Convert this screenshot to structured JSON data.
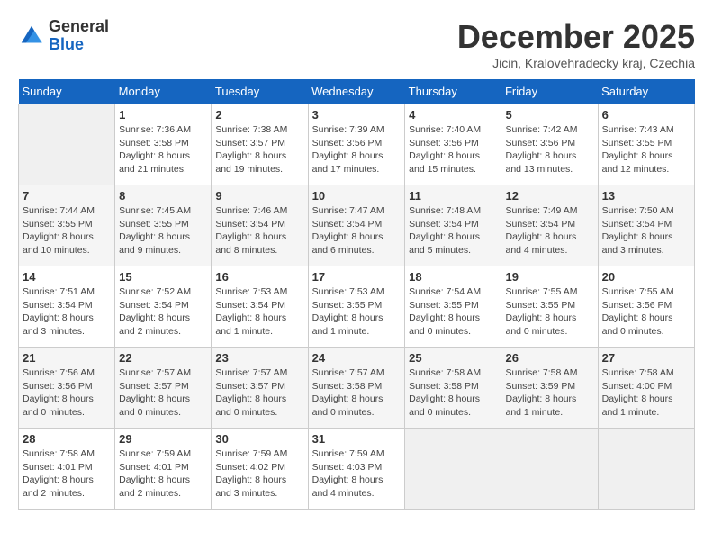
{
  "header": {
    "logo_general": "General",
    "logo_blue": "Blue",
    "title": "December 2025",
    "subtitle": "Jicin, Kralovehradecky kraj, Czechia"
  },
  "days_of_week": [
    "Sunday",
    "Monday",
    "Tuesday",
    "Wednesday",
    "Thursday",
    "Friday",
    "Saturday"
  ],
  "weeks": [
    [
      {
        "day": "",
        "info": ""
      },
      {
        "day": "1",
        "info": "Sunrise: 7:36 AM\nSunset: 3:58 PM\nDaylight: 8 hours\nand 21 minutes."
      },
      {
        "day": "2",
        "info": "Sunrise: 7:38 AM\nSunset: 3:57 PM\nDaylight: 8 hours\nand 19 minutes."
      },
      {
        "day": "3",
        "info": "Sunrise: 7:39 AM\nSunset: 3:56 PM\nDaylight: 8 hours\nand 17 minutes."
      },
      {
        "day": "4",
        "info": "Sunrise: 7:40 AM\nSunset: 3:56 PM\nDaylight: 8 hours\nand 15 minutes."
      },
      {
        "day": "5",
        "info": "Sunrise: 7:42 AM\nSunset: 3:56 PM\nDaylight: 8 hours\nand 13 minutes."
      },
      {
        "day": "6",
        "info": "Sunrise: 7:43 AM\nSunset: 3:55 PM\nDaylight: 8 hours\nand 12 minutes."
      }
    ],
    [
      {
        "day": "7",
        "info": "Sunrise: 7:44 AM\nSunset: 3:55 PM\nDaylight: 8 hours\nand 10 minutes."
      },
      {
        "day": "8",
        "info": "Sunrise: 7:45 AM\nSunset: 3:55 PM\nDaylight: 8 hours\nand 9 minutes."
      },
      {
        "day": "9",
        "info": "Sunrise: 7:46 AM\nSunset: 3:54 PM\nDaylight: 8 hours\nand 8 minutes."
      },
      {
        "day": "10",
        "info": "Sunrise: 7:47 AM\nSunset: 3:54 PM\nDaylight: 8 hours\nand 6 minutes."
      },
      {
        "day": "11",
        "info": "Sunrise: 7:48 AM\nSunset: 3:54 PM\nDaylight: 8 hours\nand 5 minutes."
      },
      {
        "day": "12",
        "info": "Sunrise: 7:49 AM\nSunset: 3:54 PM\nDaylight: 8 hours\nand 4 minutes."
      },
      {
        "day": "13",
        "info": "Sunrise: 7:50 AM\nSunset: 3:54 PM\nDaylight: 8 hours\nand 3 minutes."
      }
    ],
    [
      {
        "day": "14",
        "info": "Sunrise: 7:51 AM\nSunset: 3:54 PM\nDaylight: 8 hours\nand 3 minutes."
      },
      {
        "day": "15",
        "info": "Sunrise: 7:52 AM\nSunset: 3:54 PM\nDaylight: 8 hours\nand 2 minutes."
      },
      {
        "day": "16",
        "info": "Sunrise: 7:53 AM\nSunset: 3:54 PM\nDaylight: 8 hours\nand 1 minute."
      },
      {
        "day": "17",
        "info": "Sunrise: 7:53 AM\nSunset: 3:55 PM\nDaylight: 8 hours\nand 1 minute."
      },
      {
        "day": "18",
        "info": "Sunrise: 7:54 AM\nSunset: 3:55 PM\nDaylight: 8 hours\nand 0 minutes."
      },
      {
        "day": "19",
        "info": "Sunrise: 7:55 AM\nSunset: 3:55 PM\nDaylight: 8 hours\nand 0 minutes."
      },
      {
        "day": "20",
        "info": "Sunrise: 7:55 AM\nSunset: 3:56 PM\nDaylight: 8 hours\nand 0 minutes."
      }
    ],
    [
      {
        "day": "21",
        "info": "Sunrise: 7:56 AM\nSunset: 3:56 PM\nDaylight: 8 hours\nand 0 minutes."
      },
      {
        "day": "22",
        "info": "Sunrise: 7:57 AM\nSunset: 3:57 PM\nDaylight: 8 hours\nand 0 minutes."
      },
      {
        "day": "23",
        "info": "Sunrise: 7:57 AM\nSunset: 3:57 PM\nDaylight: 8 hours\nand 0 minutes."
      },
      {
        "day": "24",
        "info": "Sunrise: 7:57 AM\nSunset: 3:58 PM\nDaylight: 8 hours\nand 0 minutes."
      },
      {
        "day": "25",
        "info": "Sunrise: 7:58 AM\nSunset: 3:58 PM\nDaylight: 8 hours\nand 0 minutes."
      },
      {
        "day": "26",
        "info": "Sunrise: 7:58 AM\nSunset: 3:59 PM\nDaylight: 8 hours\nand 1 minute."
      },
      {
        "day": "27",
        "info": "Sunrise: 7:58 AM\nSunset: 4:00 PM\nDaylight: 8 hours\nand 1 minute."
      }
    ],
    [
      {
        "day": "28",
        "info": "Sunrise: 7:58 AM\nSunset: 4:01 PM\nDaylight: 8 hours\nand 2 minutes."
      },
      {
        "day": "29",
        "info": "Sunrise: 7:59 AM\nSunset: 4:01 PM\nDaylight: 8 hours\nand 2 minutes."
      },
      {
        "day": "30",
        "info": "Sunrise: 7:59 AM\nSunset: 4:02 PM\nDaylight: 8 hours\nand 3 minutes."
      },
      {
        "day": "31",
        "info": "Sunrise: 7:59 AM\nSunset: 4:03 PM\nDaylight: 8 hours\nand 4 minutes."
      },
      {
        "day": "",
        "info": ""
      },
      {
        "day": "",
        "info": ""
      },
      {
        "day": "",
        "info": ""
      }
    ]
  ]
}
